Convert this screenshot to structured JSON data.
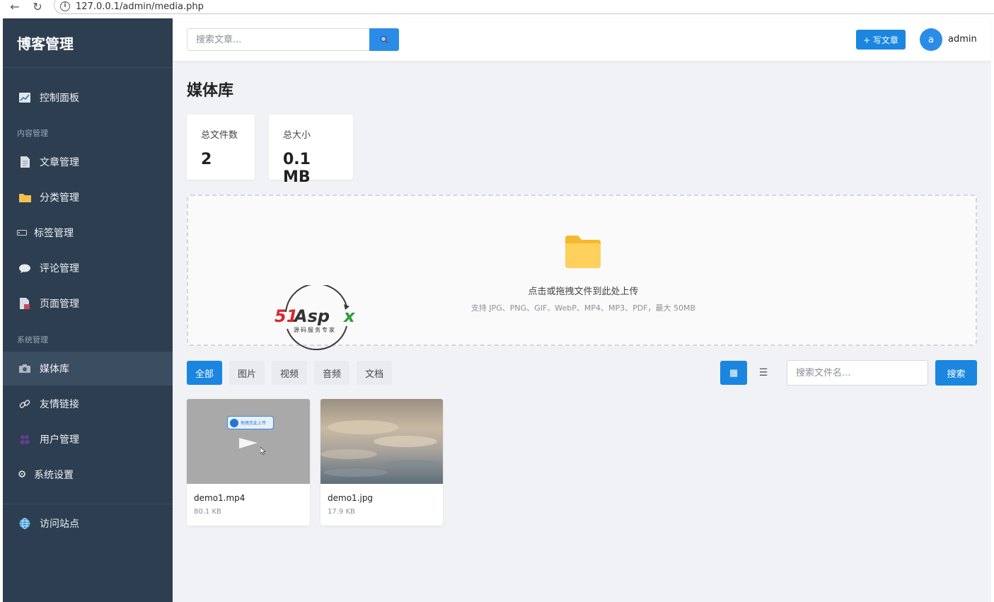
{
  "browser": {
    "url": "127.0.0.1/admin/media.php"
  },
  "sidebar": {
    "brand": "博客管理",
    "items": [
      {
        "label": "控制面板",
        "icon": "chart-icon"
      },
      {
        "label": "文章管理",
        "icon": "document-icon"
      },
      {
        "label": "分类管理",
        "icon": "folder-icon"
      },
      {
        "label": "标签管理",
        "icon": "tag-icon"
      },
      {
        "label": "评论管理",
        "icon": "comment-icon"
      },
      {
        "label": "页面管理",
        "icon": "page-icon"
      },
      {
        "label": "媒体库",
        "icon": "camera-icon"
      },
      {
        "label": "友情链接",
        "icon": "link-icon"
      },
      {
        "label": "用户管理",
        "icon": "users-icon"
      },
      {
        "label": "系统设置",
        "icon": "gear-icon"
      },
      {
        "label": "访问站点",
        "icon": "globe-icon"
      }
    ],
    "sections": [
      "内容管理",
      "系统管理"
    ],
    "active": "媒体库"
  },
  "topbar": {
    "search_placeholder": "搜索文章...",
    "write_label": "+ 写文章",
    "avatar_letter": "a",
    "username": "admin"
  },
  "main": {
    "title": "媒体库",
    "stats": [
      {
        "label": "总文件数",
        "value": "2"
      },
      {
        "label": "总大小",
        "value": "0.1 MB"
      }
    ],
    "dropzone": {
      "main_text": "点击或拖拽文件到此处上传",
      "sub_text": "支持 JPG、PNG、GIF、WebP、MP4、MP3、PDF，最大 50MB"
    },
    "watermark": {
      "logo_text": "51Aspx",
      "tagline": "源码服务专家"
    },
    "filters": [
      "全部",
      "图片",
      "视频",
      "音频",
      "文档"
    ],
    "active_filter": "全部",
    "file_search_placeholder": "搜索文件名...",
    "file_search_button": "搜索",
    "files": [
      {
        "name": "demo1.mp4",
        "size": "80.1 KB",
        "type": "video",
        "thumb_badge": "拖拽至此上传"
      },
      {
        "name": "demo1.jpg",
        "size": "17.9 KB",
        "type": "image"
      }
    ]
  }
}
